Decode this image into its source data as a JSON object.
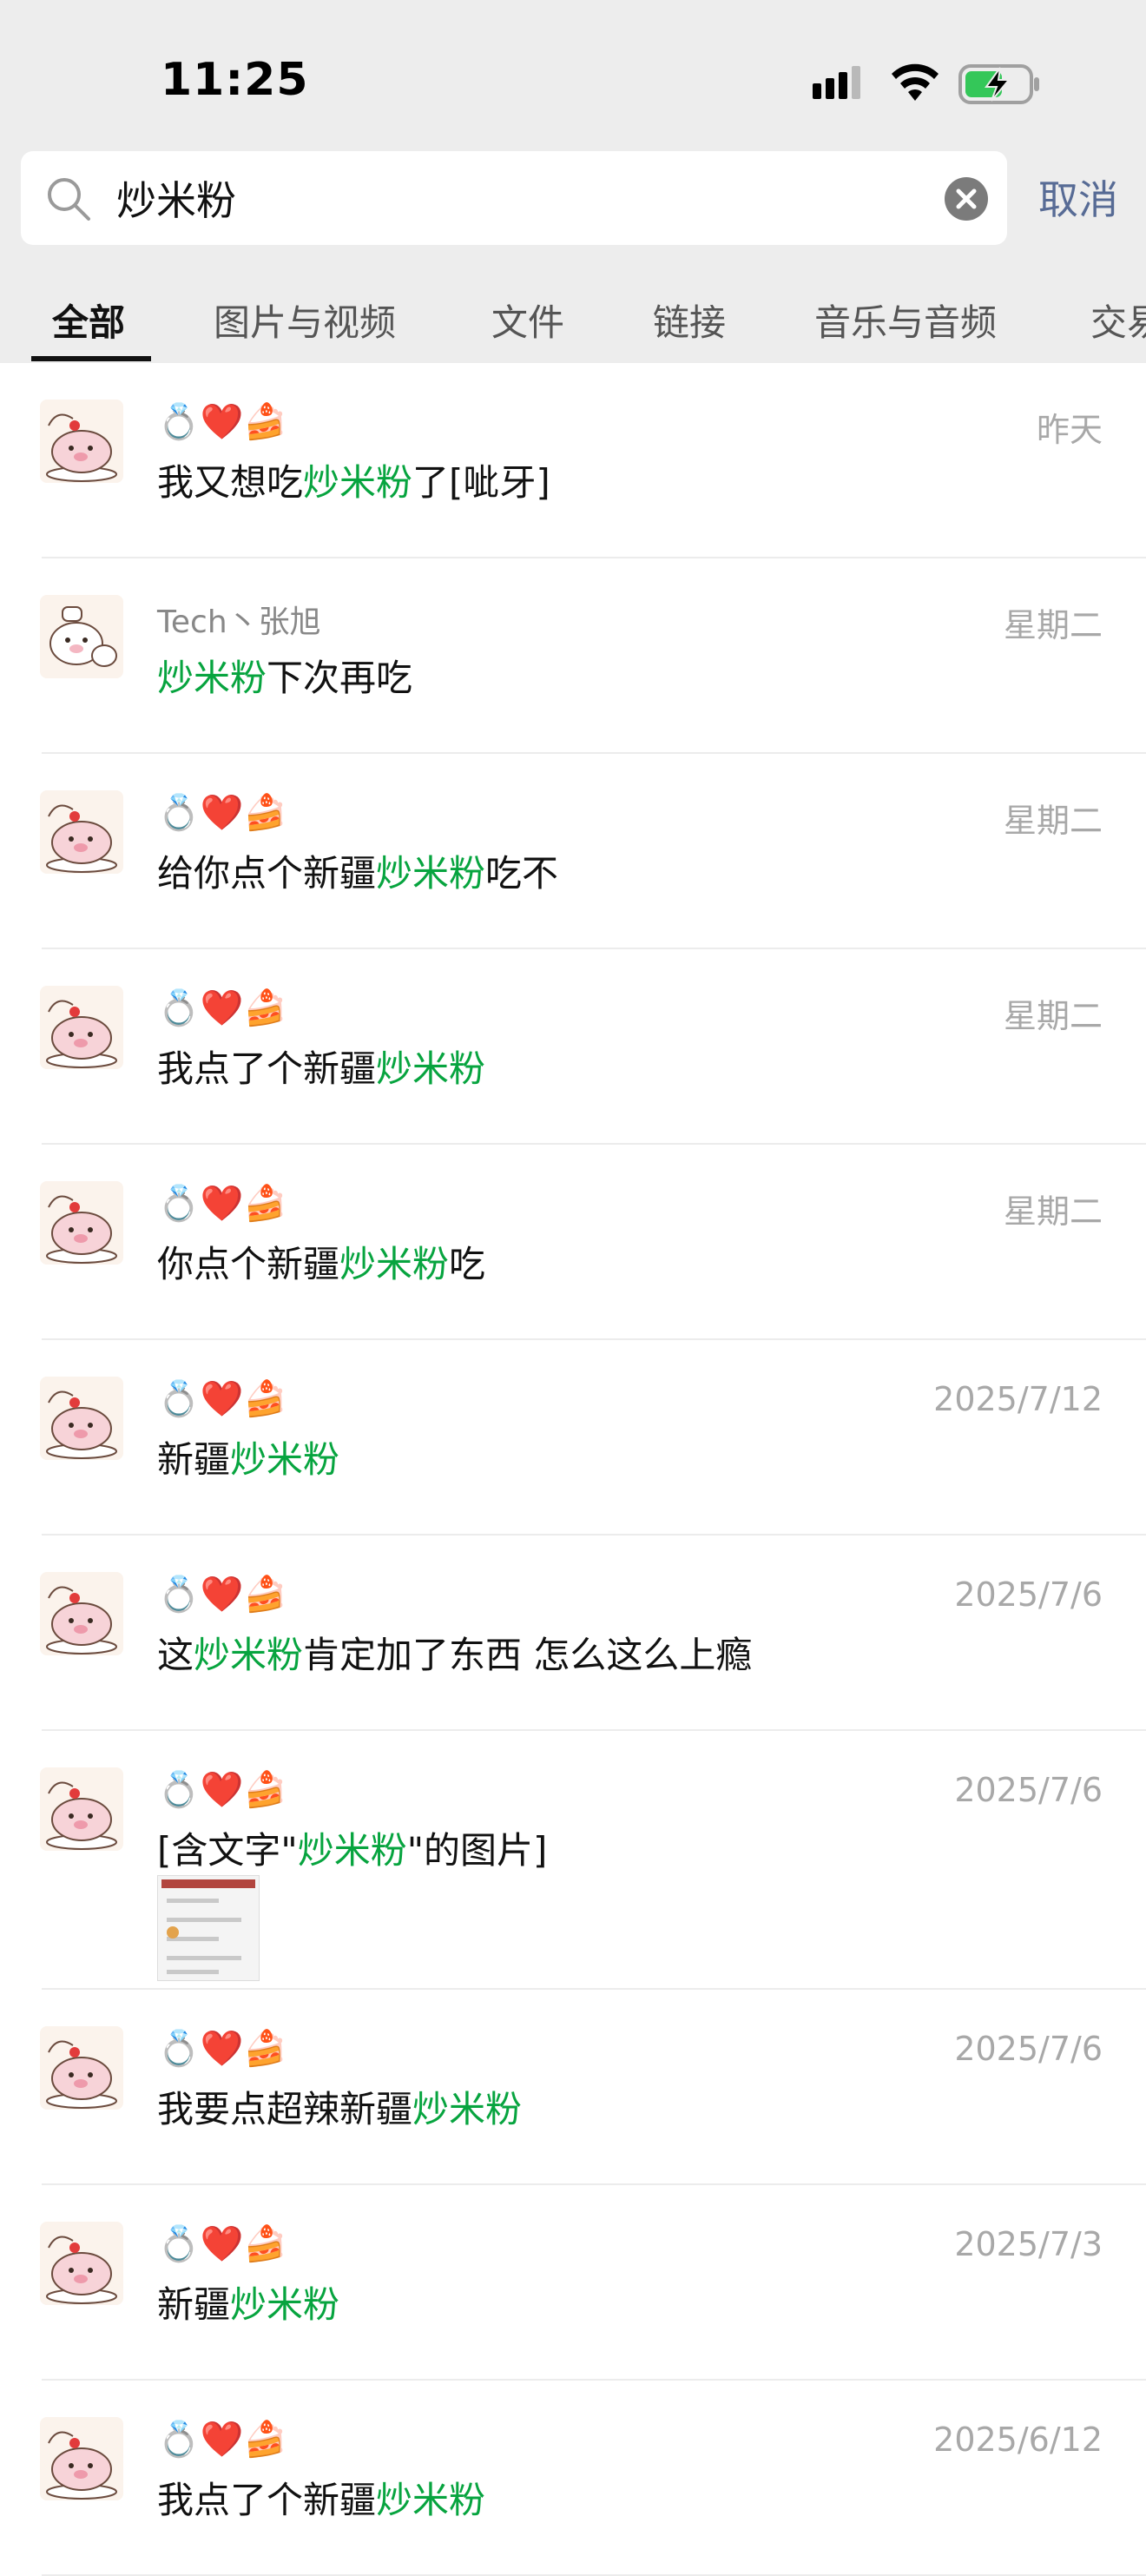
{
  "status_bar": {
    "time": "11:25",
    "signal_icon": "signal-icon",
    "wifi_icon": "wifi-icon",
    "battery_icon": "battery-charging-icon"
  },
  "search": {
    "value": "炒米粉",
    "placeholder": "",
    "clear_icon": "clear-icon",
    "cancel_label": "取消"
  },
  "tabs": [
    {
      "label": "全部",
      "active": true
    },
    {
      "label": "图片与视频",
      "active": false
    },
    {
      "label": "文件",
      "active": false
    },
    {
      "label": "链接",
      "active": false
    },
    {
      "label": "音乐与音频",
      "active": false
    },
    {
      "label": "交易",
      "active": false
    }
  ],
  "colors": {
    "highlight": "#07a43f",
    "cancel": "#576b95",
    "header_bg": "#ededed"
  },
  "results": [
    {
      "sender": "💍❤️🍰",
      "time": "昨天",
      "message": {
        "before": "我又想吃",
        "highlight": "炒米粉",
        "after": "了[呲牙]"
      },
      "avatar": "pig-avatar"
    },
    {
      "sender": "Tech丶张旭",
      "time": "星期二",
      "message": {
        "before": "",
        "highlight": "炒米粉",
        "after": "下次再吃"
      },
      "avatar": "pig-avatar-2"
    },
    {
      "sender": "💍❤️🍰",
      "time": "星期二",
      "message": {
        "before": "给你点个新疆",
        "highlight": "炒米粉",
        "after": "吃不"
      },
      "avatar": "pig-avatar"
    },
    {
      "sender": "💍❤️🍰",
      "time": "星期二",
      "message": {
        "before": "我点了个新疆",
        "highlight": "炒米粉",
        "after": ""
      },
      "avatar": "pig-avatar"
    },
    {
      "sender": "💍❤️🍰",
      "time": "星期二",
      "message": {
        "before": "你点个新疆",
        "highlight": "炒米粉",
        "after": "吃"
      },
      "avatar": "pig-avatar"
    },
    {
      "sender": "💍❤️🍰",
      "time": "2025/7/12",
      "message": {
        "before": "新疆",
        "highlight": "炒米粉",
        "after": ""
      },
      "avatar": "pig-avatar"
    },
    {
      "sender": "💍❤️🍰",
      "time": "2025/7/6",
      "message": {
        "before": "这",
        "highlight": "炒米粉",
        "after": "肯定加了东西 怎么这么上瘾"
      },
      "avatar": "pig-avatar"
    },
    {
      "sender": "💍❤️🍰",
      "time": "2025/7/6",
      "message": {
        "before": "[含文字\"",
        "highlight": "炒米粉",
        "after": "\"的图片]"
      },
      "avatar": "pig-avatar",
      "has_thumbnail": true
    },
    {
      "sender": "💍❤️🍰",
      "time": "2025/7/6",
      "message": {
        "before": "我要点超辣新疆",
        "highlight": "炒米粉",
        "after": ""
      },
      "avatar": "pig-avatar"
    },
    {
      "sender": "💍❤️🍰",
      "time": "2025/7/3",
      "message": {
        "before": "新疆",
        "highlight": "炒米粉",
        "after": ""
      },
      "avatar": "pig-avatar"
    },
    {
      "sender": "💍❤️🍰",
      "time": "2025/6/12",
      "message": {
        "before": "我点了个新疆",
        "highlight": "炒米粉",
        "after": ""
      },
      "avatar": "pig-avatar"
    }
  ]
}
